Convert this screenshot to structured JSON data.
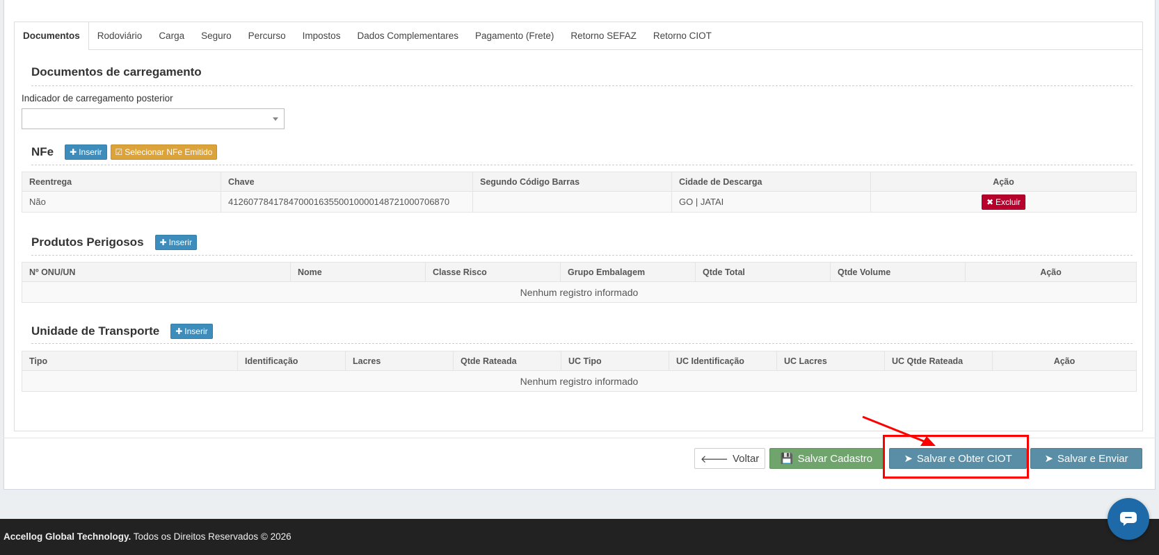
{
  "tabs": [
    "Documentos",
    "Rodoviário",
    "Carga",
    "Seguro",
    "Percurso",
    "Impostos",
    "Dados Complementares",
    "Pagamento (Frete)",
    "Retorno SEFAZ",
    "Retorno CIOT"
  ],
  "docs_section": {
    "title": "Documentos de carregamento",
    "field_label": "Indicador de carregamento posterior",
    "select_value": ""
  },
  "nfe": {
    "title": "NFe",
    "insert_label": "Inserir",
    "select_label": "Selecionar NFe Emitido",
    "headers": [
      "Reentrega",
      "Chave",
      "Segundo Código Barras",
      "Cidade de Descarga",
      "Ação"
    ],
    "rows": [
      {
        "reentrega": "Não",
        "chave": "41260778417847000163550010000148721000706870",
        "segundo": "",
        "cidade": "GO | JATAI",
        "action": "Excluir"
      }
    ]
  },
  "produtos": {
    "title": "Produtos Perigosos",
    "insert_label": "Inserir",
    "headers": [
      "Nº ONU/UN",
      "Nome",
      "Classe Risco",
      "Grupo Embalagem",
      "Qtde Total",
      "Qtde Volume",
      "Ação"
    ],
    "empty": "Nenhum registro informado"
  },
  "unidade": {
    "title": "Unidade de Transporte",
    "insert_label": "Inserir",
    "headers": [
      "Tipo",
      "Identificação",
      "Lacres",
      "Qtde Rateada",
      "UC Tipo",
      "UC Identificação",
      "UC Lacres",
      "UC Qtde Rateada",
      "Ação"
    ],
    "empty": "Nenhum registro informado"
  },
  "actions": {
    "back": "Voltar",
    "save": "Salvar Cadastro",
    "save_ciot": "Salvar e Obter CIOT",
    "save_send": "Salvar e Enviar"
  },
  "footer": {
    "brand": "Accellog Global Technology.",
    "rights": "Todos os Direitos Reservados © 2026"
  },
  "colors": {
    "primary": "#3c8dbc",
    "danger": "#b8002c",
    "warning": "#dca33a",
    "success": "#6fa46c",
    "steel": "#5a8ea6",
    "highlight": "#ff0000"
  }
}
